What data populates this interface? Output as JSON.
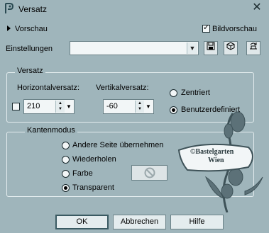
{
  "window": {
    "title": "Versatz"
  },
  "preview": {
    "label": "Vorschau"
  },
  "bildvorschau": {
    "label": "Bildvorschau",
    "checked": true
  },
  "settings": {
    "label": "Einstellungen",
    "value": ""
  },
  "offset_group": {
    "title": "Versatz",
    "horizontal": {
      "label": "Horizontalversatz:",
      "value": "210"
    },
    "vertical": {
      "label": "Vertikalversatz:",
      "value": "-60"
    },
    "options": [
      {
        "label": "Zentriert",
        "selected": false
      },
      {
        "label": "Benutzerdefiniert",
        "selected": true
      }
    ]
  },
  "edge_group": {
    "title": "Kantenmodus",
    "options": [
      {
        "label": "Andere Seite übernehmen",
        "selected": false
      },
      {
        "label": "Wiederholen",
        "selected": false
      },
      {
        "label": "Farbe",
        "selected": false
      },
      {
        "label": "Transparent",
        "selected": true
      }
    ]
  },
  "watermark": {
    "line1": "©Bastelgarten",
    "line2": "Wien"
  },
  "buttons": {
    "ok": "OK",
    "cancel": "Abbrechen",
    "help": "Hilfe"
  },
  "icons": {
    "app": "app-logo-icon",
    "close": "close-icon",
    "save": "save-icon",
    "random": "dice-icon",
    "reset": "reset-icon",
    "disabled": "no-color-icon"
  },
  "colors": {
    "background": "#9fb5bb",
    "group_border": "#e3ecee"
  }
}
